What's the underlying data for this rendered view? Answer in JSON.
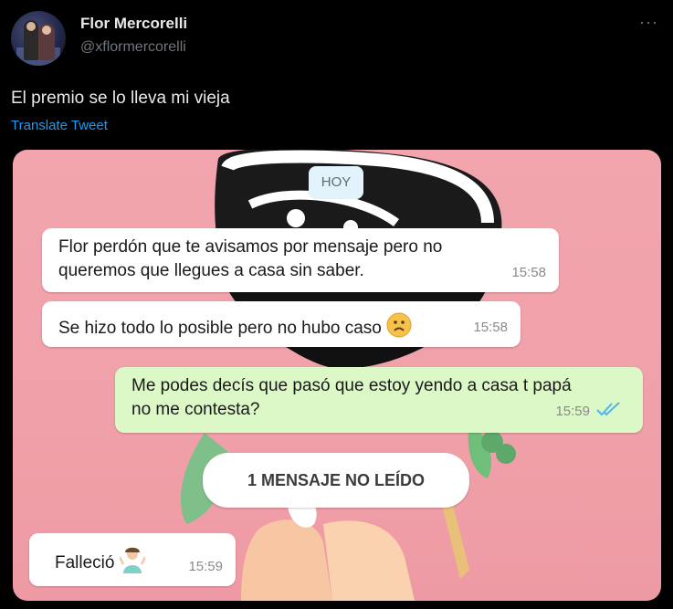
{
  "author": {
    "name": "Flor Mercorelli",
    "handle": "@xflormercorelli"
  },
  "more_label": "···",
  "tweet": {
    "text": "El premio se lo lleva mi vieja",
    "translate_label": "Translate Tweet"
  },
  "chat": {
    "date_label": "HOY",
    "messages": [
      {
        "direction": "in",
        "text_lines": [
          "Flor perdón que te avisamos por mensaje pero no",
          "queremos que llegues a casa sin saber."
        ],
        "time": "15:58"
      },
      {
        "direction": "in",
        "text_lines": [
          "Se hizo todo lo posible pero no hubo caso"
        ],
        "emoji": "sad-face-emoji",
        "time": "15:58"
      },
      {
        "direction": "out",
        "text_lines": [
          "Me podes decís que pasó que estoy yendo a casa t papá",
          "no me contesta?"
        ],
        "time": "15:59",
        "read_receipt": "double-check-blue"
      },
      {
        "direction": "in",
        "text_lines": [
          "Falleció"
        ],
        "emoji": "person-shrugging-emoji",
        "time": "15:59"
      }
    ],
    "unread_label": "1 MENSAJE NO LEÍDO"
  },
  "colors": {
    "background": "#000000",
    "link": "#1d9bf0",
    "chat_background": "#f0a0a8",
    "incoming_bubble": "#ffffff",
    "outgoing_bubble": "#dcf8c6",
    "read_check": "#4fb6ec"
  }
}
